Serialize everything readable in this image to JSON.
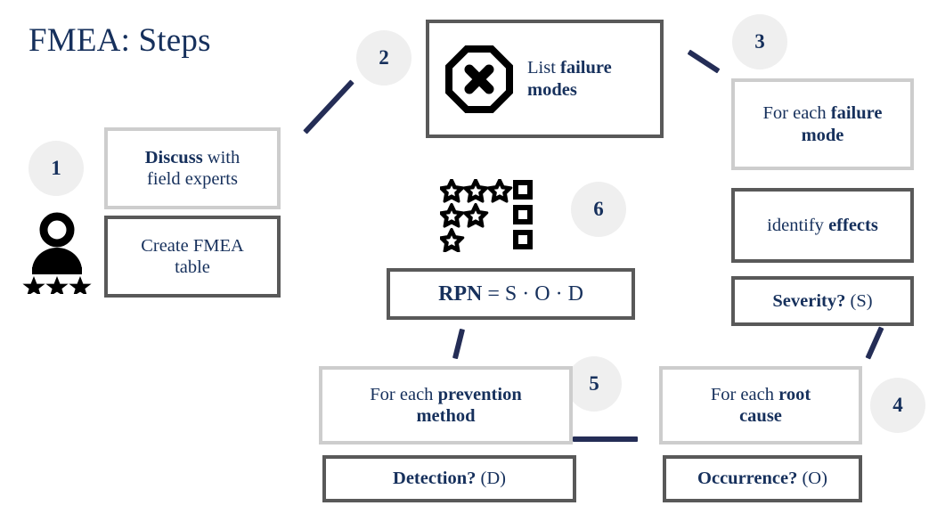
{
  "title": "FMEA: Steps",
  "colors": {
    "text_navy": "#16305c",
    "line_navy": "#242d56",
    "border_light": "#cdcdcd",
    "border_dark": "#595959",
    "badge_fill": "#efefef",
    "icon_black": "#000000",
    "background": "#ffffff"
  },
  "badges": [
    {
      "id": "1",
      "label": "1"
    },
    {
      "id": "2",
      "label": "2"
    },
    {
      "id": "3",
      "label": "3"
    },
    {
      "id": "4",
      "label": "4"
    },
    {
      "id": "5",
      "label": "5"
    },
    {
      "id": "6",
      "label": "6"
    }
  ],
  "steps": {
    "step1": {
      "icon": "person-with-three-stars-icon",
      "boxes": [
        {
          "name": "discuss-with-field-experts",
          "border": "light",
          "bold_part": "Discuss",
          "rest": " with field experts"
        },
        {
          "name": "create-fmea-table",
          "border": "dark",
          "bold_part": "",
          "rest": "Create FMEA table"
        }
      ]
    },
    "step2": {
      "icon": "octagon-x-icon",
      "boxes": [
        {
          "name": "list-failure-modes",
          "border": "dark",
          "bold_part": "failure modes",
          "rest": "List "
        }
      ]
    },
    "step3": {
      "boxes": [
        {
          "name": "for-each-failure-mode",
          "border": "light",
          "bold_part": "failure mode",
          "rest": "For each "
        },
        {
          "name": "identify-effects",
          "border": "dark",
          "bold_part": "effects",
          "rest": "identify "
        },
        {
          "name": "severity-s",
          "border": "dark",
          "bold_part": "Severity?",
          "rest": " (S)"
        }
      ]
    },
    "step4": {
      "boxes": [
        {
          "name": "for-each-root-cause",
          "border": "light",
          "bold_part": "root cause",
          "rest": "For each "
        },
        {
          "name": "occurrence-o",
          "border": "dark",
          "bold_part": "Occurrence?",
          "rest": " (O)"
        }
      ]
    },
    "step5": {
      "boxes": [
        {
          "name": "for-each-prevention-method",
          "border": "light",
          "bold_part": "prevention method",
          "rest": "For each "
        },
        {
          "name": "detection-d",
          "border": "dark",
          "bold_part": "Detection?",
          "rest": " (D)"
        }
      ]
    },
    "step6": {
      "icon": "stars-and-squares-rating-icon",
      "star_count": 6,
      "square_count": 3,
      "star_rows": [
        3,
        2,
        1
      ],
      "boxes": [
        {
          "name": "rpn-formula",
          "border": "dark",
          "bold_part": "RPN",
          "rest": " = S · O · D"
        }
      ]
    }
  },
  "box_text": {
    "discuss_bold": "Discuss",
    "discuss_rest": " with",
    "discuss_line2": "field experts",
    "create_fmea": "Create FMEA",
    "create_fmea_line2": "table",
    "list_prefix": "List ",
    "list_bold": "failure",
    "list_bold2": "modes",
    "failure_mode_prefix": "For each ",
    "failure_mode_bold": "failure",
    "failure_mode_bold2": "mode",
    "identify_prefix": "identify ",
    "identify_bold": "effects",
    "severity_bold": "Severity?",
    "severity_rest": " (S)",
    "root_cause_prefix": "For each ",
    "root_cause_bold": "root",
    "root_cause_bold2": "cause",
    "occurrence_bold": "Occurrence?",
    "occurrence_rest": " (O)",
    "prevention_prefix": "For each ",
    "prevention_bold": "prevention",
    "prevention_bold2": "method",
    "detection_bold": "Detection?",
    "detection_rest": " (D)",
    "rpn_bold": "RPN",
    "rpn_rest": " = S · O · D"
  }
}
